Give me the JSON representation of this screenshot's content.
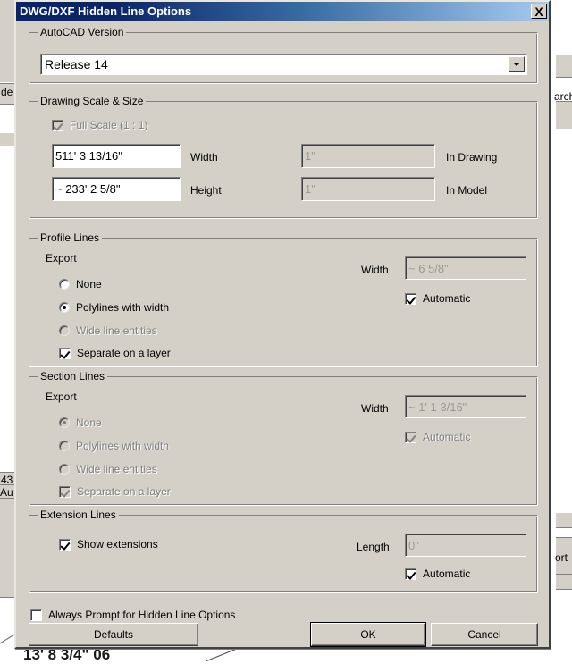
{
  "window": {
    "title": "DWG/DXF Hidden Line Options",
    "close_icon": "close-icon",
    "close_label": "X"
  },
  "groups": {
    "autocad_version": {
      "label": "AutoCAD Version",
      "combo": {
        "selected": "Release 14",
        "arrow_icon": "chevron-down-icon"
      }
    },
    "drawing_scale": {
      "label": "Drawing Scale & Size",
      "full_scale": {
        "label": "Full Scale (1 : 1)",
        "checked": true,
        "enabled": false
      },
      "width": {
        "value": "511' 3 13/16\"",
        "label": "Width"
      },
      "height": {
        "value": "~ 233' 2 5/8\"",
        "label": "Height"
      },
      "in_drawing": {
        "value": "1\"",
        "label": "In Drawing",
        "enabled": false
      },
      "in_model": {
        "value": "1\"",
        "label": "In Model",
        "enabled": false
      }
    },
    "profile_lines": {
      "label": "Profile Lines",
      "export_label": "Export",
      "options": [
        {
          "label": "None",
          "selected": false,
          "enabled": true
        },
        {
          "label": "Polylines with width",
          "selected": true,
          "enabled": true
        },
        {
          "label": "Wide line entities",
          "selected": false,
          "enabled": false
        }
      ],
      "separate_layer": {
        "label": "Separate on a layer",
        "checked": true,
        "enabled": true
      },
      "width_label": "Width",
      "width_value": "~ 6 5/8\"",
      "width_enabled": false,
      "automatic": {
        "label": "Automatic",
        "checked": true,
        "enabled": true
      }
    },
    "section_lines": {
      "label": "Section Lines",
      "export_label": "Export",
      "options": [
        {
          "label": "None",
          "selected": true,
          "enabled": false
        },
        {
          "label": "Polylines with width",
          "selected": false,
          "enabled": false
        },
        {
          "label": "Wide line entities",
          "selected": false,
          "enabled": false
        }
      ],
      "separate_layer": {
        "label": "Separate on a layer",
        "checked": true,
        "enabled": false
      },
      "width_label": "Width",
      "width_value": "~ 1' 1 3/16\"",
      "width_enabled": false,
      "automatic": {
        "label": "Automatic",
        "checked": true,
        "enabled": false
      }
    },
    "extension_lines": {
      "label": "Extension Lines",
      "show_extensions": {
        "label": "Show extensions",
        "checked": true,
        "enabled": true
      },
      "length_label": "Length",
      "length_value": "0\"",
      "length_enabled": false,
      "automatic": {
        "label": "Automatic",
        "checked": true,
        "enabled": true
      }
    }
  },
  "always_prompt": {
    "label": "Always Prompt for Hidden Line Options",
    "checked": false
  },
  "buttons": {
    "defaults": "Defaults",
    "ok": "OK",
    "cancel": "Cancel"
  },
  "background": {
    "left_text_1": "de",
    "left_text_2": "43",
    "left_text_3": "Au",
    "right_text_1": "arch",
    "right_text_2": "ort",
    "bottom_text": "13' 8 3/4\" 06"
  },
  "colors": {
    "title_start": "#0a246a",
    "title_end": "#a6caf0",
    "face": "#d4d0c8",
    "shadow": "#808080",
    "text": "#000000",
    "disabled_text": "#808080"
  }
}
